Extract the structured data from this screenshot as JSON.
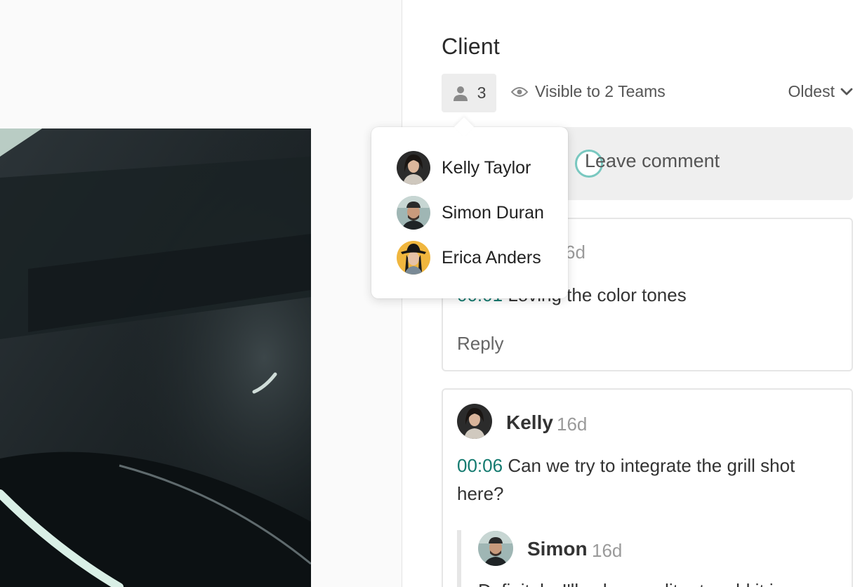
{
  "panel": {
    "title": "Client",
    "members_count": "3",
    "visibility_label": "Visible to 2 Teams",
    "sort_label": "Oldest",
    "leave_comment_placeholder": "Leave comment"
  },
  "members_popover": {
    "members": [
      {
        "name": "Kelly Taylor",
        "avatar_bg": "#2b2b2b"
      },
      {
        "name": "Simon Duran",
        "avatar_bg": "#9fb6b4"
      },
      {
        "name": "Erica Anders",
        "avatar_bg": "#f0b63e"
      }
    ]
  },
  "comments": [
    {
      "time_visible": "6d",
      "timestamp_visible": "00:01",
      "text_visible": "Loving the color tones",
      "reply_label": "Reply"
    },
    {
      "author": "Kelly",
      "time": "16d",
      "timestamp": "00:06",
      "text": "Can we try to integrate the grill shot here?",
      "replies": [
        {
          "author": "Simon",
          "time": "16d",
          "text_partial": "Definitely, I'll ask our editor to add it in"
        }
      ]
    }
  ],
  "colors": {
    "timestamp_teal": "#137a6f",
    "accent_teal_ring": "#79c8c0",
    "panel_bg": "#ffffff",
    "chip_bg": "#ededed"
  },
  "icons": [
    "person-icon",
    "eye-icon",
    "chevron-down-icon"
  ]
}
